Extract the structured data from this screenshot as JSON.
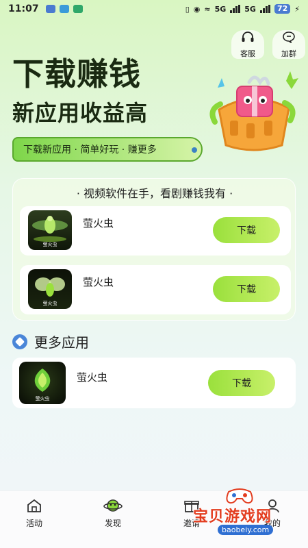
{
  "status_bar": {
    "time": "11:07",
    "signal_1": "5G",
    "signal_2": "5G",
    "battery": "72"
  },
  "top_buttons": {
    "service_label": "客服",
    "group_label": "加群"
  },
  "hero": {
    "title": "下载赚钱",
    "subtitle": "新应用收益高",
    "tagline": "下载新应用 · 简单好玩 · 赚更多"
  },
  "featured": {
    "header": "· 视频软件在手，看剧赚钱我有 ·",
    "apps": [
      {
        "name": "萤火虫",
        "icon_label": "萤火虫",
        "button": "下载"
      },
      {
        "name": "萤火虫",
        "icon_label": "萤火虫",
        "button": "下载"
      }
    ]
  },
  "more": {
    "title": "更多应用",
    "apps": [
      {
        "name": "萤火虫",
        "icon_label": "萤火虫",
        "button": "下载"
      }
    ]
  },
  "bottom_nav": {
    "items": [
      {
        "label": "活动",
        "icon": "home-icon"
      },
      {
        "label": "发现",
        "icon": "planet-icon"
      },
      {
        "label": "邀请",
        "icon": "gift-icon"
      },
      {
        "label": "我的",
        "icon": "user-icon"
      }
    ]
  },
  "watermark": {
    "text": "宝贝游戏网",
    "url": "baobeiy.com"
  },
  "colors": {
    "accent_green": "#9ae03c",
    "dark_text": "#1a2a12",
    "battery_blue": "#4a7bd0",
    "watermark_red": "#e33d20"
  }
}
